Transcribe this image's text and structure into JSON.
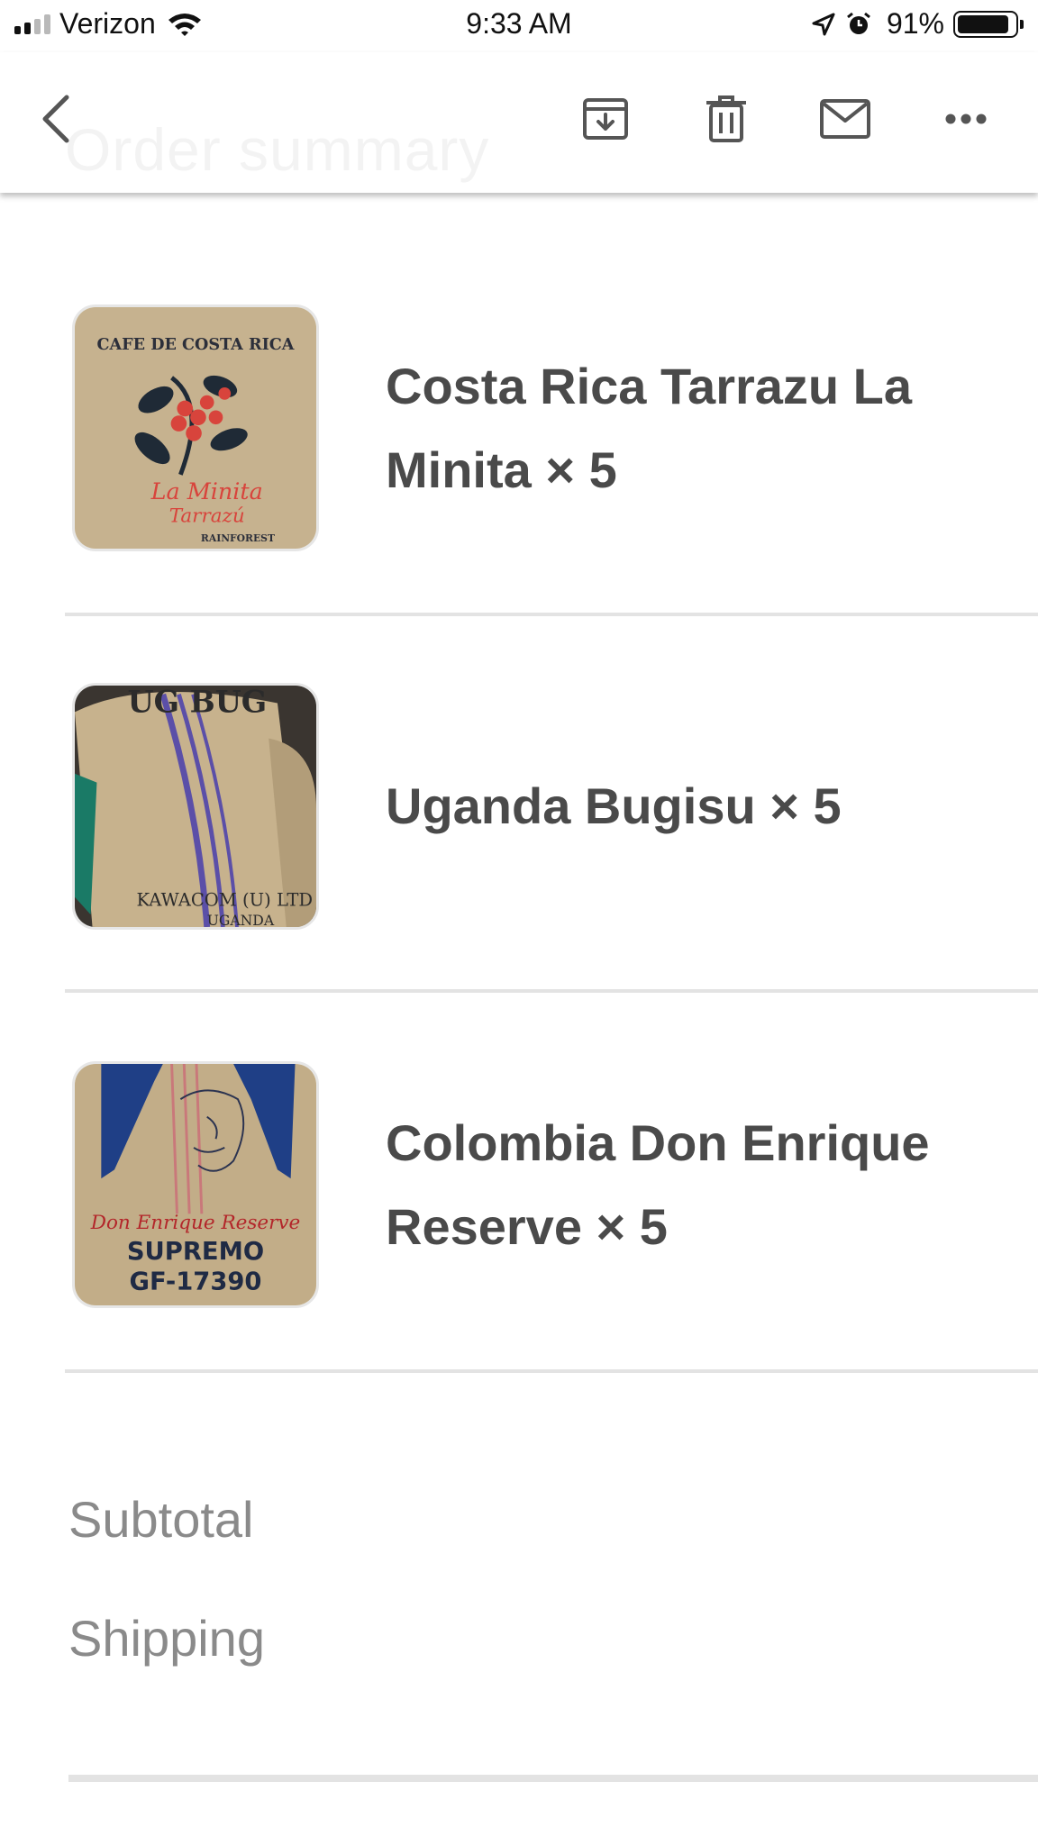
{
  "status_bar": {
    "carrier": "Verizon",
    "time": "9:33 AM",
    "battery_percent": "91%",
    "battery_level": 0.91,
    "icons": [
      "signal-icon",
      "wifi-icon",
      "location-arrow-icon",
      "alarm-icon",
      "battery-icon"
    ]
  },
  "toolbar": {
    "ghost_title": "Order summary",
    "icons": [
      "back-chevron-icon",
      "archive-icon",
      "trash-icon",
      "mail-icon",
      "more-icon"
    ]
  },
  "items": [
    {
      "name": "Costa Rica Tarrazu La Minita × 5",
      "image_text": [
        "CAFE DE COSTA RICA",
        "La Minita",
        "Tarrazú",
        "RAINFOREST"
      ]
    },
    {
      "name": "Uganda Bugisu × 5",
      "image_text": [
        "UG BUG",
        "KAWACOM (U) LTD",
        "UGANDA"
      ]
    },
    {
      "name": "Colombia Don Enrique Reserve × 5",
      "image_text": [
        "Don Enrique Reserve",
        "SUPREMO",
        "GF-17390"
      ]
    }
  ],
  "summary": {
    "subtotal_label": "Subtotal",
    "shipping_label": "Shipping"
  },
  "colors": {
    "text_dark": "#4a4a4a",
    "text_muted": "#8a8a8a",
    "divider": "#e3e3e3",
    "burlap": "#c9b48f"
  }
}
